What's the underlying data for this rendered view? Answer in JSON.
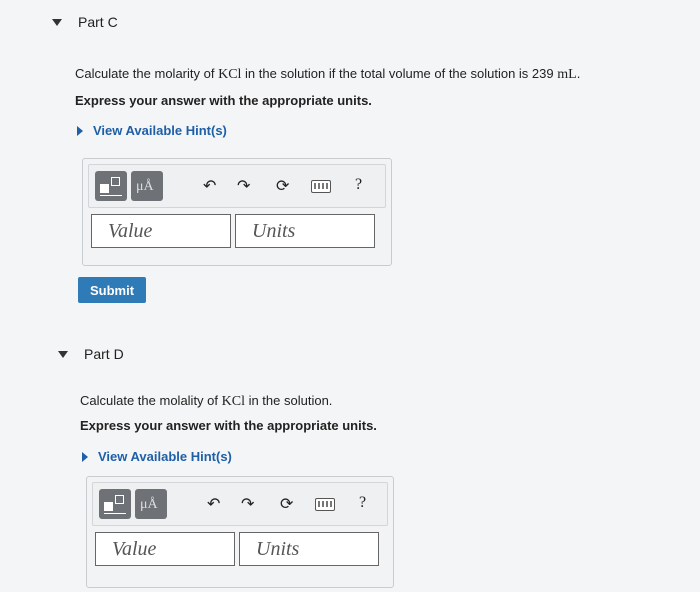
{
  "part_c": {
    "title": "Part C",
    "prompt_before": "Calculate the molarity of ",
    "prompt_chem": "KCl",
    "prompt_middle": " in the solution if the total volume of the solution is 239 ",
    "prompt_unit": "mL",
    "prompt_end": ".",
    "instruction": "Express your answer with the appropriate units.",
    "hint_label": "View Available Hint(s)",
    "value_placeholder": "Value",
    "units_placeholder": "Units",
    "units_button_label": "μÅ",
    "help_label": "?",
    "submit_label": "Submit"
  },
  "part_d": {
    "title": "Part D",
    "prompt_before": "Calculate the molality of ",
    "prompt_chem": "KCl",
    "prompt_end": " in the solution.",
    "instruction": "Express your answer with the appropriate units.",
    "hint_label": "View Available Hint(s)",
    "value_placeholder": "Value",
    "units_placeholder": "Units",
    "units_button_label": "μÅ",
    "help_label": "?"
  },
  "toolbar_icons": [
    "templates-icon",
    "units-icon",
    "undo-icon",
    "redo-icon",
    "reset-icon",
    "keyboard-icon",
    "help-icon"
  ]
}
